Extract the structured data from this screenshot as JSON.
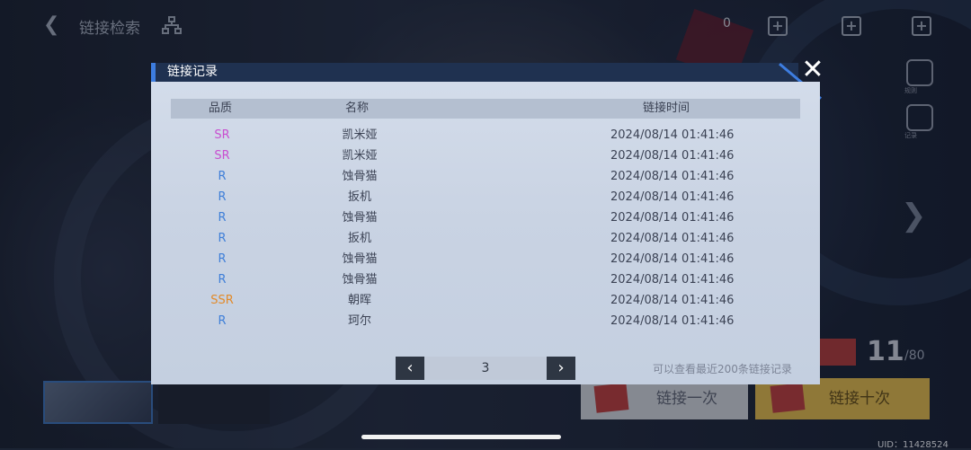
{
  "background": {
    "top_title": "链接检索",
    "resource_count": "0",
    "side_labels": [
      "规则",
      "记录"
    ],
    "pull_once_label": "链接一次",
    "pull_ten_label": "链接十次",
    "pity_count": "11",
    "pity_total": "/80",
    "ticket_label": "",
    "uid": "UID：11428524"
  },
  "dialog": {
    "title": "链接记录",
    "columns": {
      "quality": "品质",
      "name": "名称",
      "time": "链接时间"
    },
    "rows": [
      {
        "quality": "SR",
        "name": "凯米娅",
        "time": "2024/08/14 01:41:46"
      },
      {
        "quality": "SR",
        "name": "凯米娅",
        "time": "2024/08/14 01:41:46"
      },
      {
        "quality": "R",
        "name": "蚀骨猫",
        "time": "2024/08/14 01:41:46"
      },
      {
        "quality": "R",
        "name": "扳机",
        "time": "2024/08/14 01:41:46"
      },
      {
        "quality": "R",
        "name": "蚀骨猫",
        "time": "2024/08/14 01:41:46"
      },
      {
        "quality": "R",
        "name": "扳机",
        "time": "2024/08/14 01:41:46"
      },
      {
        "quality": "R",
        "name": "蚀骨猫",
        "time": "2024/08/14 01:41:46"
      },
      {
        "quality": "R",
        "name": "蚀骨猫",
        "time": "2024/08/14 01:41:46"
      },
      {
        "quality": "SSR",
        "name": "朝晖",
        "time": "2024/08/14 01:41:46"
      },
      {
        "quality": "R",
        "name": "珂尔",
        "time": "2024/08/14 01:41:46"
      }
    ],
    "pager": {
      "prev": "‹",
      "next": "›",
      "page": "3"
    },
    "note": "可以查看最近200条链接记录"
  },
  "colors": {
    "SR": "#c94fd0",
    "R": "#3f7fd8",
    "SSR": "#e28a2a",
    "header": "#1f3150",
    "accent": "#3d7de0"
  }
}
